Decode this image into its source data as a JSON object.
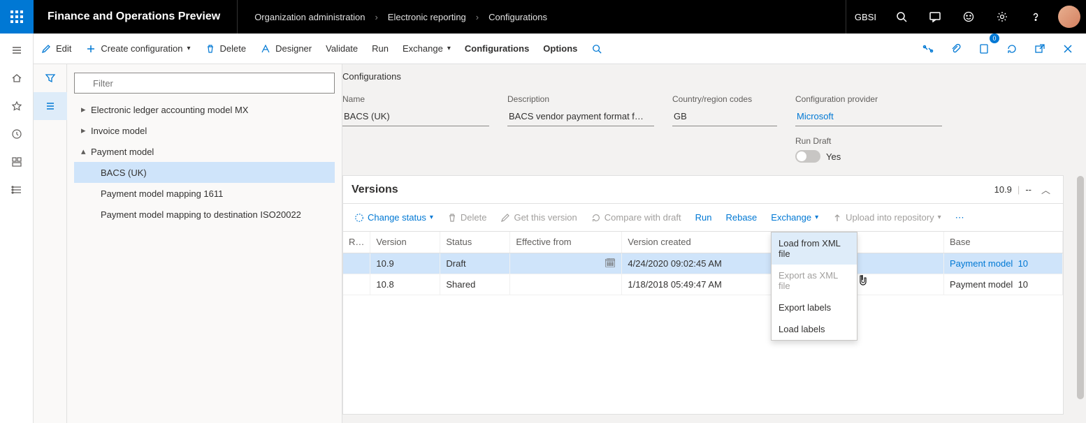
{
  "app": {
    "title": "Finance and Operations Preview"
  },
  "breadcrumb": [
    "Organization administration",
    "Electronic reporting",
    "Configurations"
  ],
  "top": {
    "company": "GBSI"
  },
  "cmdbar": {
    "edit": "Edit",
    "create": "Create configuration",
    "delete": "Delete",
    "designer": "Designer",
    "validate": "Validate",
    "run": "Run",
    "exchange": "Exchange",
    "configurations": "Configurations",
    "options": "Options"
  },
  "filter": {
    "placeholder": "Filter"
  },
  "tree": {
    "n0": "Electronic ledger accounting model MX",
    "n1": "Invoice model",
    "n2": "Payment model",
    "n2a": "BACS (UK)",
    "n2b": "Payment model mapping 1611",
    "n2c": "Payment model mapping to destination ISO20022"
  },
  "form": {
    "section": "Configurations",
    "name_label": "Name",
    "name_val": "BACS (UK)",
    "desc_label": "Description",
    "desc_val": "BACS vendor payment format f…",
    "country_label": "Country/region codes",
    "country_val": "GB",
    "provider_label": "Configuration provider",
    "provider_val": "Microsoft",
    "rundraft_label": "Run Draft",
    "rundraft_val": "Yes"
  },
  "versions": {
    "title": "Versions",
    "headnum": "10.9",
    "headdash": "--",
    "toolbar": {
      "change": "Change status",
      "delete": "Delete",
      "get": "Get this version",
      "compare": "Compare with draft",
      "run": "Run",
      "rebase": "Rebase",
      "exchange": "Exchange",
      "upload": "Upload into repository"
    },
    "cols": {
      "r": "R…",
      "version": "Version",
      "status": "Status",
      "effective": "Effective from",
      "created": "Version created",
      "base": "Base"
    },
    "rows": [
      {
        "version": "10.9",
        "status": "Draft",
        "effective": "",
        "created": "4/24/2020 09:02:45 AM",
        "base": "Payment model",
        "basenum": "10"
      },
      {
        "version": "10.8",
        "status": "Shared",
        "effective": "",
        "created": "1/18/2018 05:49:47 AM",
        "base": "Payment model",
        "basenum": "10"
      }
    ]
  },
  "dropdown": {
    "load_xml": "Load from XML file",
    "export_xml": "Export as XML file",
    "export_labels": "Export labels",
    "load_labels": "Load labels"
  },
  "badge": "0"
}
